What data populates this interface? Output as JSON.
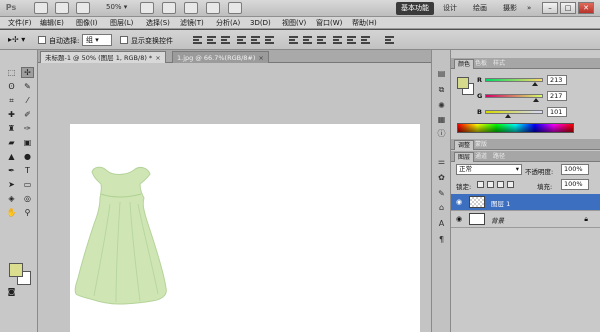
{
  "app": {
    "logo": "Ps",
    "zoom": "50%",
    "workspaces": [
      "基本功能",
      "设计",
      "绘画",
      "摄影"
    ],
    "workspace_more": "»",
    "window_controls": [
      "–",
      "□",
      "✕"
    ]
  },
  "menu": [
    "文件(F)",
    "编辑(E)",
    "图像(I)",
    "图层(L)",
    "选择(S)",
    "滤镜(T)",
    "分析(A)",
    "3D(D)",
    "视图(V)",
    "窗口(W)",
    "帮助(H)"
  ],
  "options": {
    "auto_select_label": "自动选择:",
    "auto_select_value": "组",
    "show_transform_label": "显示变换控件"
  },
  "documents": {
    "tabs": [
      {
        "label": "未标题-1 @ 50% (图层 1, RGB/8) *",
        "close": "×"
      },
      {
        "label": "1.jpg @ 66.7%(RGB/8#)",
        "close": "×"
      }
    ]
  },
  "color_panel": {
    "tabs": [
      "颜色",
      "色板",
      "样式"
    ],
    "channels": [
      {
        "label": "R",
        "value": "213",
        "ratio": 0.835
      },
      {
        "label": "G",
        "value": "217",
        "ratio": 0.851
      },
      {
        "label": "B",
        "value": "101",
        "ratio": 0.396
      }
    ],
    "foreground": "#d5d965",
    "background": "#ffffff"
  },
  "adjust_tabs": [
    "调整",
    "蒙版"
  ],
  "layers_panel": {
    "tabs": [
      "图层",
      "通道",
      "路径"
    ],
    "blend_mode": "正常",
    "opacity_label": "不透明度:",
    "opacity_value": "100%",
    "lock_label": "锁定:",
    "fill_label": "填充:",
    "fill_value": "100%",
    "layers": [
      {
        "name": "图层 1",
        "selected": true
      },
      {
        "name": "背景",
        "selected": false
      }
    ]
  },
  "colors": {
    "selection": "#3d6fc0",
    "dress_fill": "#cfe6b4",
    "dress_stroke": "#b4d39a"
  }
}
